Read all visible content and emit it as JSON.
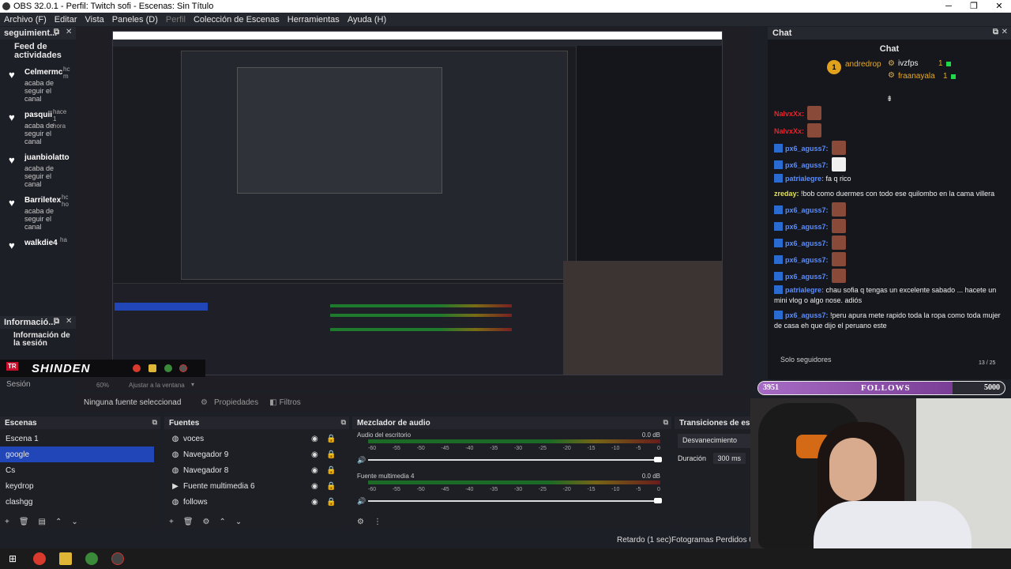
{
  "window": {
    "title": "OBS 32.0.1 - Perfil: Twitch sofi - Escenas: Sin Título"
  },
  "menu": {
    "items": [
      "Archivo (F)",
      "Editar",
      "Vista",
      "Paneles (D)",
      "Perfil",
      "Colección de Escenas",
      "Herramientas",
      "Ayuda (H)"
    ]
  },
  "feed": {
    "header": "seguimient...",
    "title": "Feed de actividades",
    "items": [
      {
        "name": "Celmermc",
        "desc": "acaba de seguir el canal",
        "time": "hc m"
      },
      {
        "name": "pasquii",
        "desc": "acaba de seguir el canal",
        "time": "hace 1 hora"
      },
      {
        "name": "juanbiolatto",
        "desc": "acaba de seguir el canal",
        "time": ""
      },
      {
        "name": "Barriletex",
        "desc": "acaba de seguir el canal",
        "time": "hc ho"
      },
      {
        "name": "walkdie4",
        "desc": "",
        "time": "ha"
      }
    ]
  },
  "info": {
    "header": "Informació...",
    "body": "Información de la sesión"
  },
  "overlay": {
    "tr": "TR",
    "logo": "SHINDEN",
    "sesion": "Sesión"
  },
  "preview": {
    "zoom": "60%",
    "fit": "Ajustar a la ventana",
    "no_source": "Ninguna fuente seleccionad",
    "properties": "Propiedades",
    "filters": "Filtros"
  },
  "scenes": {
    "header": "Escenas",
    "items": [
      "Escena 1",
      "google",
      "Cs",
      "keydrop",
      "clashgg"
    ],
    "selected": "google"
  },
  "sources": {
    "header": "Fuentes",
    "items": [
      {
        "icon": "browser-icon",
        "label": "voces"
      },
      {
        "icon": "browser-icon",
        "label": "Navegador 9"
      },
      {
        "icon": "browser-icon",
        "label": "Navegador 8"
      },
      {
        "icon": "play-icon",
        "label": "Fuente multimedia 6"
      },
      {
        "icon": "browser-icon",
        "label": "follows"
      }
    ]
  },
  "mixer": {
    "header": "Mezclador de audio",
    "tracks": [
      {
        "name": "Audio del escritorio",
        "db": "0.0 dB"
      },
      {
        "name": "Fuente multimedia 4",
        "db": "0.0 dB"
      }
    ],
    "scale": [
      "-60",
      "-55",
      "-50",
      "-45",
      "-40",
      "-35",
      "-30",
      "-25",
      "-20",
      "-15",
      "-10",
      "-5",
      "0"
    ]
  },
  "transitions": {
    "header": "Transiciones de esce",
    "type": "Desvanecimiento",
    "duration_label": "Duración",
    "duration": "300 ms"
  },
  "status": {
    "delay": "Retardo (1 sec)",
    "frames": "Fotogramas Perdidos 0 (0"
  },
  "chat": {
    "header": "Chat",
    "title": "Chat",
    "top": [
      {
        "rank": "1",
        "name": "andredrop"
      },
      {
        "rank": "2",
        "name": "ivzfps",
        "value": "1"
      },
      {
        "rank": "3",
        "name": "fraanayala",
        "value": "1"
      }
    ],
    "messages": [
      {
        "user": "NaIvxXx:",
        "style": "red",
        "text": "",
        "emote": "emote"
      },
      {
        "user": "NaIvxXx:",
        "style": "red",
        "text": "",
        "emote": "emote"
      },
      {
        "user": "px6_aguss7:",
        "style": "blue",
        "text": "",
        "emote": "emote"
      },
      {
        "user": "px6_aguss7:",
        "style": "blue",
        "text": "",
        "emote": "ghost"
      },
      {
        "user": "patrialegre:",
        "style": "blue",
        "text": "fa q rico",
        "emote": ""
      },
      {
        "user": "zreday:",
        "style": "yel",
        "text": "!bob como duermes con todo ese quilombo en la cama villera",
        "emote": ""
      },
      {
        "user": "px6_aguss7:",
        "style": "blue",
        "text": "",
        "emote": "emote"
      },
      {
        "user": "px6_aguss7:",
        "style": "blue",
        "text": "",
        "emote": "emote"
      },
      {
        "user": "px6_aguss7:",
        "style": "blue",
        "text": "",
        "emote": "emote"
      },
      {
        "user": "px6_aguss7:",
        "style": "blue",
        "text": "",
        "emote": "emote"
      },
      {
        "user": "px6_aguss7:",
        "style": "blue",
        "text": "",
        "emote": "emote"
      },
      {
        "user": "patrialegre:",
        "style": "blue",
        "text": "chau sofia q tengas un excelente sabado ... hacete un mini vlog o algo nose. adiós",
        "emote": ""
      },
      {
        "user": "px6_aguss7:",
        "style": "blue",
        "text": "!peru apura mete rapido toda la ropa como toda mujer de casa eh que dijo el peruano este",
        "emote": ""
      }
    ],
    "solo": "Solo seguidores",
    "solo_count": "13 / 25"
  },
  "follows": {
    "count": "3951",
    "label": "FOLLOWS",
    "goal": "5000",
    "progress": 0.79
  },
  "colors": {
    "accent": "#2146b8",
    "gold": "#e0a21d",
    "purple": "#a66bc4"
  }
}
